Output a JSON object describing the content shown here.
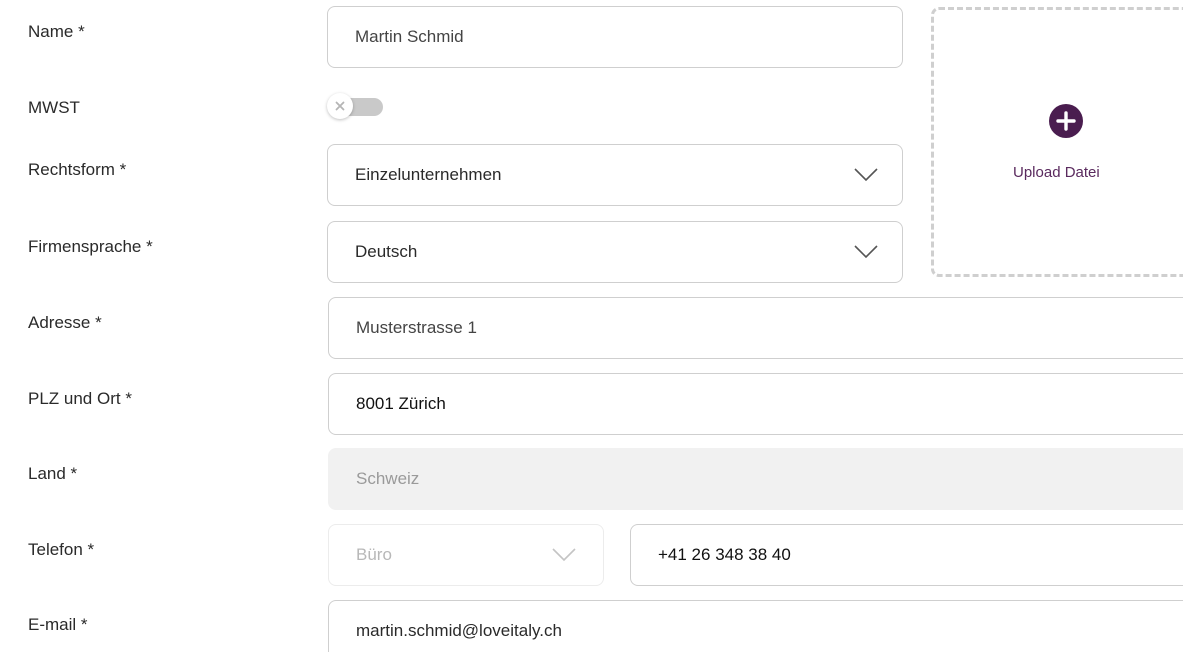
{
  "form": {
    "name_label": "Name *",
    "name_value": "Martin Schmid",
    "mwst_label": "MWST",
    "mwst_enabled": false,
    "rechtsform_label": "Rechtsform *",
    "rechtsform_value": "Einzelunternehmen",
    "firmensprache_label": "Firmensprache *",
    "firmensprache_value": "Deutsch",
    "adresse_label": "Adresse *",
    "adresse_value": "Musterstrasse 1",
    "plz_label": "PLZ und Ort *",
    "plz_value": "8001 Zürich",
    "land_label": "Land *",
    "land_value": "Schweiz",
    "telefon_label": "Telefon  *",
    "telefon_type_value": "Büro",
    "telefon_value": "+41 26 348 38 40",
    "email_label": "E-mail *",
    "email_value": "martin.schmid@loveitaly.ch"
  },
  "upload": {
    "label": "Upload Datei",
    "icon": "plus-circle-icon"
  },
  "colors": {
    "accent": "#4a1d4f",
    "toggle_off": "#c9c9c9",
    "border": "#cfcfcf",
    "disabled_bg": "#f1f1f1"
  }
}
